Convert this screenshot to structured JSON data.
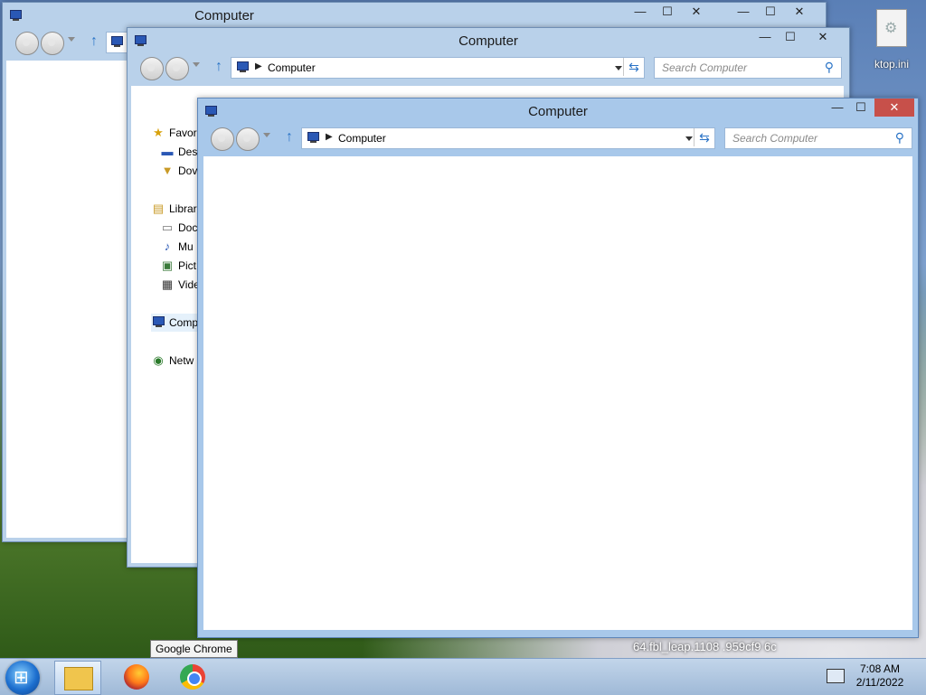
{
  "desktop": {
    "icon_label": "ktop.ini",
    "bottom_text": "64.fbl_leap.1108 .959cf9 6c"
  },
  "windows": {
    "back": {
      "title": "Computer"
    },
    "middle": {
      "title": "Computer",
      "address": "Computer",
      "search_placeholder": "Search Computer",
      "nav": [
        {
          "label": "Favor",
          "icon": "star-icon"
        },
        {
          "label": "Des",
          "icon": "desktop-icon"
        },
        {
          "label": "Dov",
          "icon": "downloads-icon"
        },
        {
          "label": "Librar",
          "icon": "libraries-icon"
        },
        {
          "label": "Doc",
          "icon": "documents-icon"
        },
        {
          "label": "Mu",
          "icon": "music-icon"
        },
        {
          "label": "Pict",
          "icon": "pictures-icon"
        },
        {
          "label": "Vide",
          "icon": "videos-icon"
        },
        {
          "label": "Comp",
          "icon": "computer-icon"
        },
        {
          "label": "Netw",
          "icon": "network-icon"
        }
      ]
    },
    "front": {
      "title": "Computer",
      "address": "Computer",
      "search_placeholder": "Search Computer"
    }
  },
  "taskbar": {
    "tooltip": "Google Chrome",
    "time": "7:08 AM",
    "date": "2/11/2022",
    "buttons": [
      "file-explorer",
      "firefox",
      "google-chrome"
    ]
  },
  "window_controls": {
    "minimize": "—",
    "maximize": "☐",
    "close": "✕"
  }
}
